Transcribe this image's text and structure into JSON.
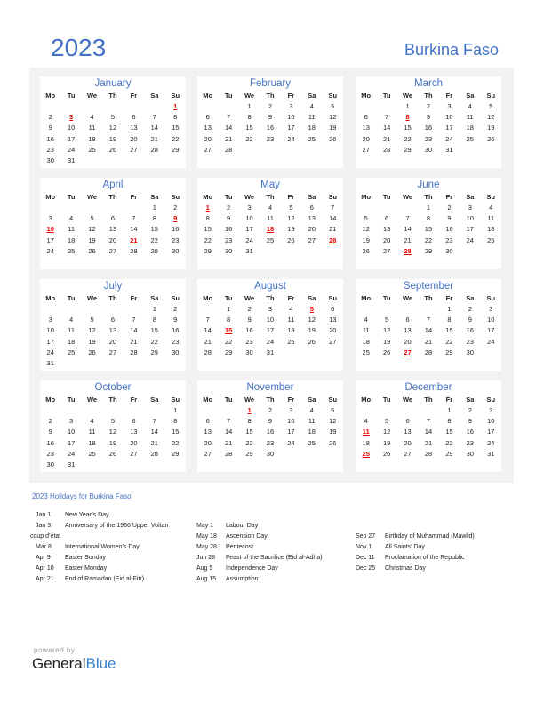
{
  "header": {
    "year": "2023",
    "country": "Burkina Faso"
  },
  "weekdays": [
    "Mo",
    "Tu",
    "We",
    "Th",
    "Fr",
    "Sa",
    "Su"
  ],
  "months": [
    {
      "name": "January",
      "offset": 6,
      "days": 31,
      "holidays": [
        1,
        3
      ]
    },
    {
      "name": "February",
      "offset": 2,
      "days": 28,
      "holidays": []
    },
    {
      "name": "March",
      "offset": 2,
      "days": 31,
      "holidays": [
        8
      ]
    },
    {
      "name": "April",
      "offset": 5,
      "days": 30,
      "holidays": [
        9,
        10,
        21
      ]
    },
    {
      "name": "May",
      "offset": 0,
      "days": 31,
      "holidays": [
        1,
        18,
        28
      ]
    },
    {
      "name": "June",
      "offset": 3,
      "days": 30,
      "holidays": [
        28
      ]
    },
    {
      "name": "July",
      "offset": 5,
      "days": 31,
      "holidays": []
    },
    {
      "name": "August",
      "offset": 1,
      "days": 31,
      "holidays": [
        5,
        15
      ]
    },
    {
      "name": "September",
      "offset": 4,
      "days": 30,
      "holidays": [
        27
      ]
    },
    {
      "name": "October",
      "offset": 6,
      "days": 31,
      "holidays": []
    },
    {
      "name": "November",
      "offset": 2,
      "days": 30,
      "holidays": [
        1
      ]
    },
    {
      "name": "December",
      "offset": 4,
      "days": 31,
      "holidays": [
        11,
        25
      ]
    }
  ],
  "holidays_title": "2023 Holidays for Burkina Faso",
  "holiday_columns": [
    [
      {
        "date": "Jan 1",
        "name": "New Year’s Day"
      },
      {
        "date": "Jan 3",
        "name": "Anniversary of the 1966 Upper Voltan"
      },
      {
        "date": "",
        "name": "coup d’état",
        "wrap": true
      },
      {
        "date": "Mar 8",
        "name": "International Women’s Day"
      },
      {
        "date": "Apr 9",
        "name": "Easter Sunday"
      },
      {
        "date": "Apr 10",
        "name": "Easter Monday"
      },
      {
        "date": "Apr 21",
        "name": "End of Ramadan (Eid al-Fitr)"
      }
    ],
    [
      {
        "date": "May 1",
        "name": "Labour Day"
      },
      {
        "date": "May 18",
        "name": "Ascension Day"
      },
      {
        "date": "May 28",
        "name": "Pentecost"
      },
      {
        "date": "Jun 28",
        "name": "Feast of the Sacrifice (Eid al-Adha)"
      },
      {
        "date": "Aug 5",
        "name": "Independence Day"
      },
      {
        "date": "Aug 15",
        "name": "Assumption"
      }
    ],
    [
      {
        "date": "Sep 27",
        "name": "Birthday of Muhammad (Mawlid)"
      },
      {
        "date": "Nov 1",
        "name": "All Saints’ Day"
      },
      {
        "date": "Dec 11",
        "name": "Proclamation of the Republic"
      },
      {
        "date": "Dec 25",
        "name": "Christmas Day"
      }
    ]
  ],
  "footer": {
    "powered_by": "powered by",
    "brand_general": "General",
    "brand_blue": "Blue"
  }
}
